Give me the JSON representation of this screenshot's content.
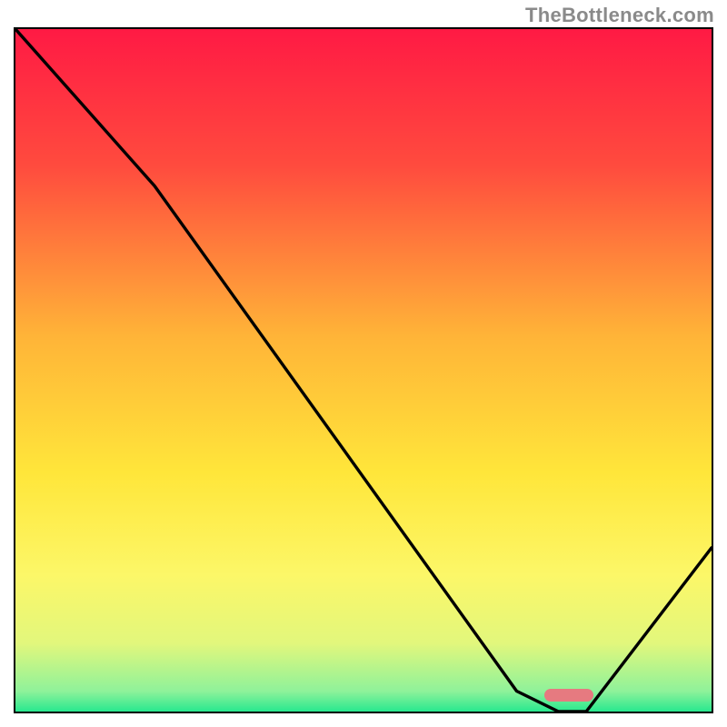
{
  "watermark": "TheBottleneck.com",
  "chart_data": {
    "type": "line",
    "title": "",
    "xlabel": "",
    "ylabel": "",
    "xlim": [
      0,
      100
    ],
    "ylim": [
      0,
      100
    ],
    "gradient_stops": [
      {
        "offset": 0,
        "color": "#ff1a44"
      },
      {
        "offset": 20,
        "color": "#ff4b3e"
      },
      {
        "offset": 45,
        "color": "#ffb438"
      },
      {
        "offset": 65,
        "color": "#ffe63a"
      },
      {
        "offset": 80,
        "color": "#fcf768"
      },
      {
        "offset": 90,
        "color": "#e2f77c"
      },
      {
        "offset": 97,
        "color": "#8ff29a"
      },
      {
        "offset": 100,
        "color": "#28e88f"
      }
    ],
    "series": [
      {
        "name": "bottleneck-curve",
        "x": [
          0,
          20,
          72,
          78,
          82,
          100
        ],
        "y": [
          100,
          77,
          3,
          0,
          0,
          24
        ]
      }
    ],
    "marker": {
      "name": "optimal-range",
      "x_start": 76,
      "x_end": 83,
      "y": 1,
      "color": "#e67a80"
    }
  }
}
